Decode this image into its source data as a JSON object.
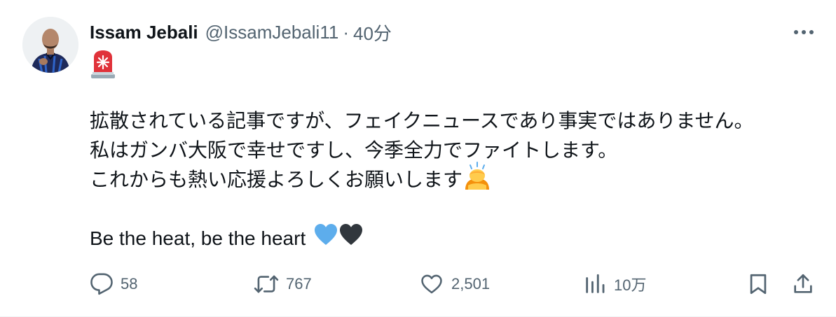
{
  "author": {
    "name": "Issam Jebali",
    "handle": "@IssamJebali11",
    "separator": "·",
    "time": "40分"
  },
  "lines": [
    "拡散されている記事ですが、フェイクニュースであり事実ではありません。",
    "私はガンバ大阪で幸せですし、今季全力でファイトします。",
    "これからも熱い応援よろしくお願いします",
    "Be the heat, be the heart"
  ],
  "emojis": {
    "top": "rotating-light-emoji",
    "line3_end": "person-bowing-emoji",
    "line4_end": [
      "blue-heart-emoji",
      "black-heart-emoji"
    ]
  },
  "actions": {
    "replies": "58",
    "reposts": "767",
    "likes": "2,501",
    "views": "10万"
  },
  "colors": {
    "text": "#0f1419",
    "muted": "#536471",
    "siren_red": "#e0323a",
    "blue_heart": "#5dadec",
    "black_heart": "#31373d"
  }
}
